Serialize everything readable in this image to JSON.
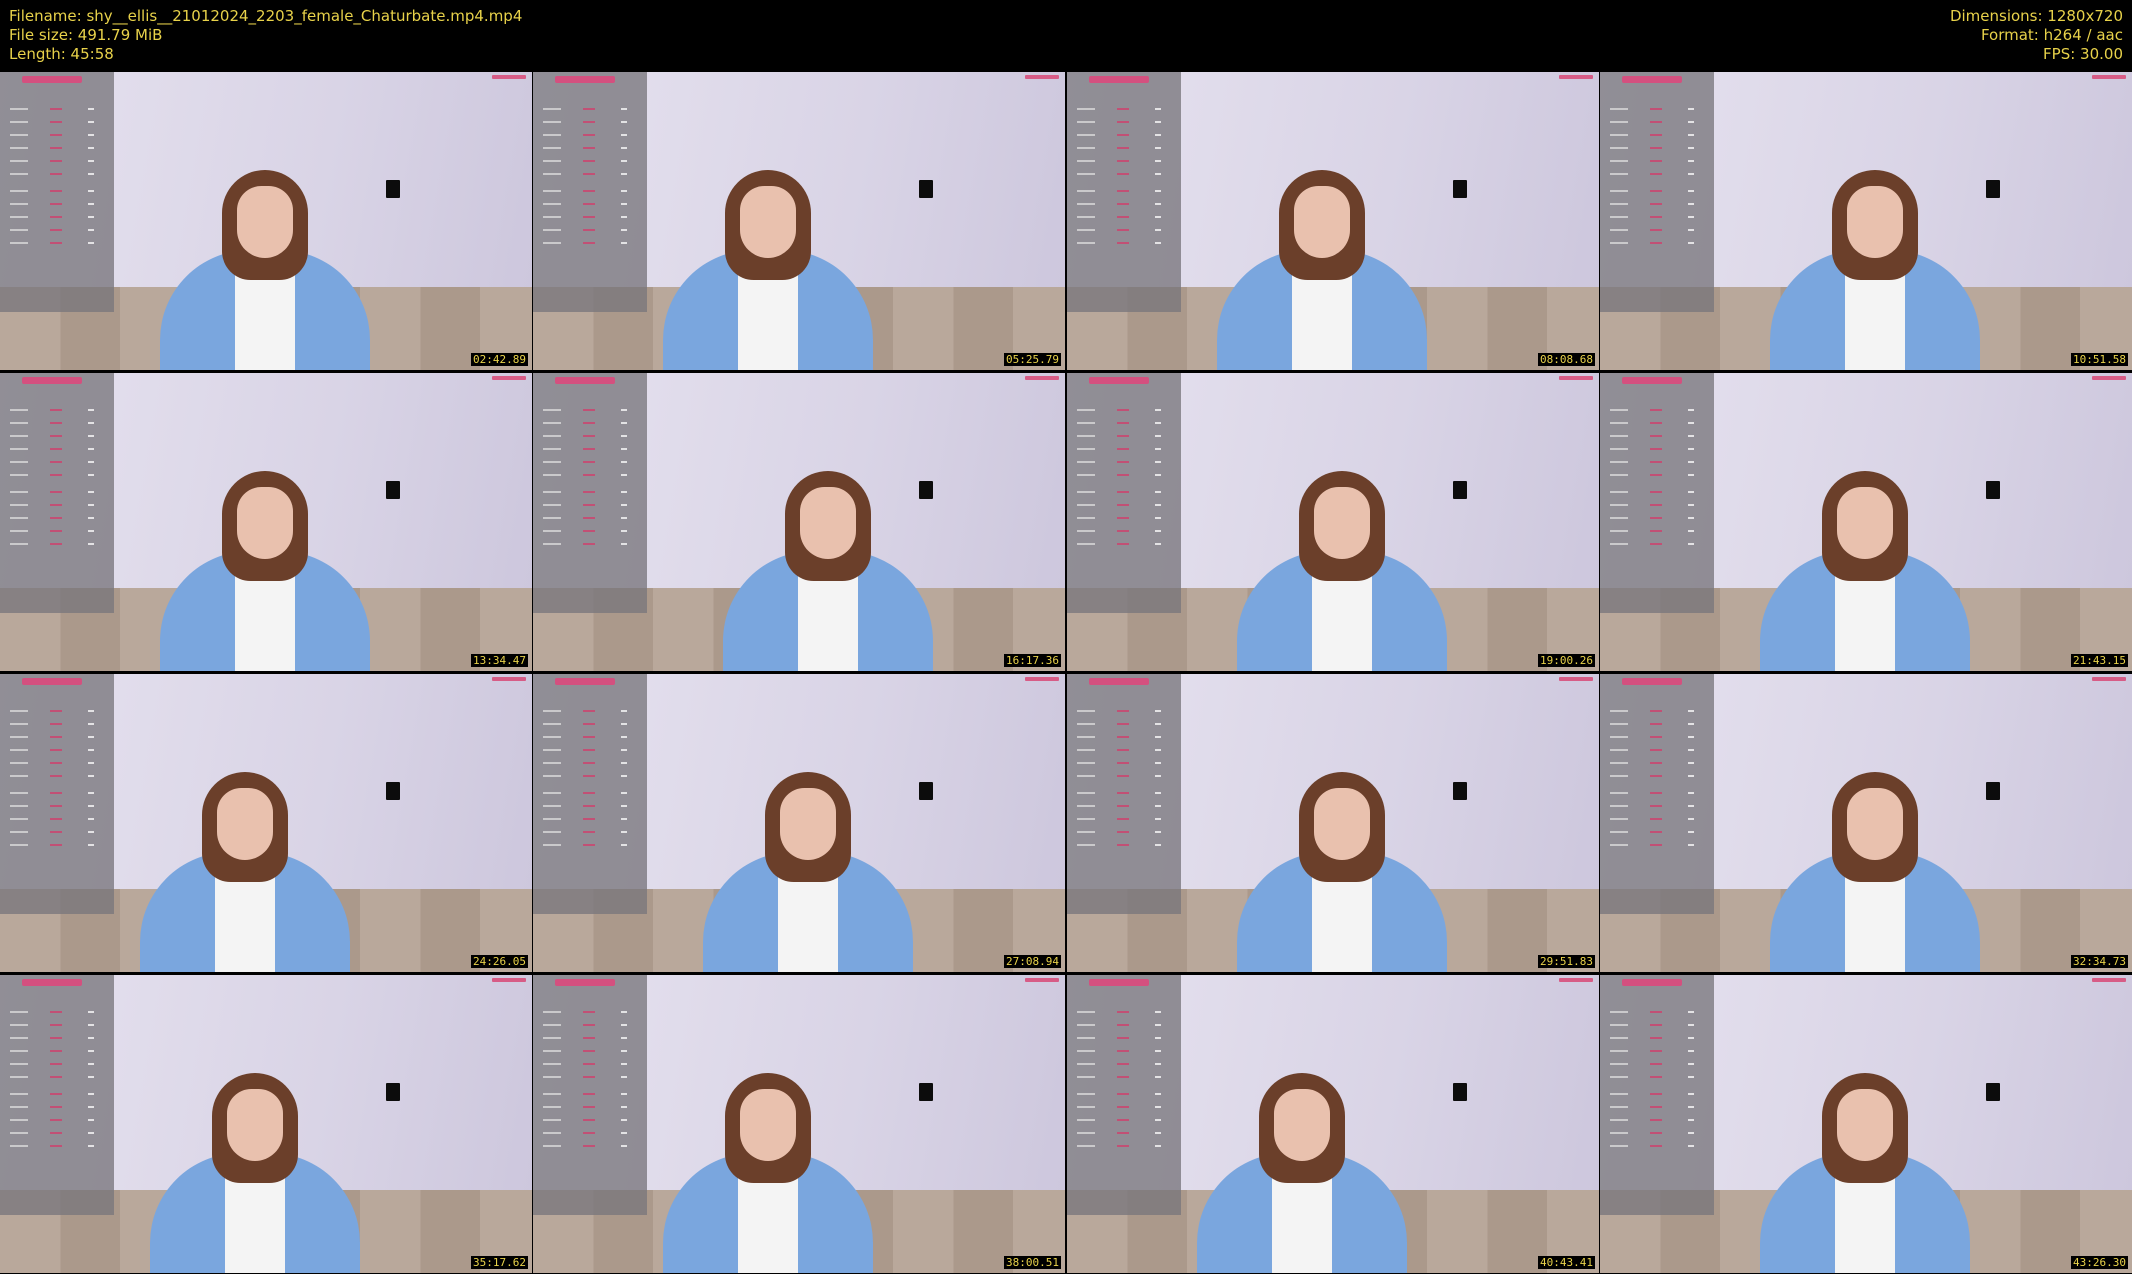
{
  "header": {
    "filename": "Filename: shy__ellis__21012024_2203_female_Chaturbate.mp4.mp4",
    "filesize": "File size: 491.79 MiB",
    "length": "Length: 45:58",
    "dimensions": "Dimensions: 1280x720",
    "format": "Format: h264 / aac",
    "fps": "FPS: 30.00"
  },
  "thumbnails": [
    {
      "timestamp": "02:42.89"
    },
    {
      "timestamp": "05:25.79"
    },
    {
      "timestamp": "08:08.68"
    },
    {
      "timestamp": "10:51.58"
    },
    {
      "timestamp": "13:34.47"
    },
    {
      "timestamp": "16:17.36"
    },
    {
      "timestamp": "19:00.26"
    },
    {
      "timestamp": "21:43.15"
    },
    {
      "timestamp": "24:26.05"
    },
    {
      "timestamp": "27:08.94"
    },
    {
      "timestamp": "29:51.83"
    },
    {
      "timestamp": "32:34.73"
    },
    {
      "timestamp": "35:17.62"
    },
    {
      "timestamp": "38:00.51"
    },
    {
      "timestamp": "40:43.41"
    },
    {
      "timestamp": "43:26.30"
    }
  ],
  "colors": {
    "background": "#000000",
    "text": "#e8d24a",
    "sweater": "#7aa6de",
    "wall": "#dcd8e6"
  }
}
